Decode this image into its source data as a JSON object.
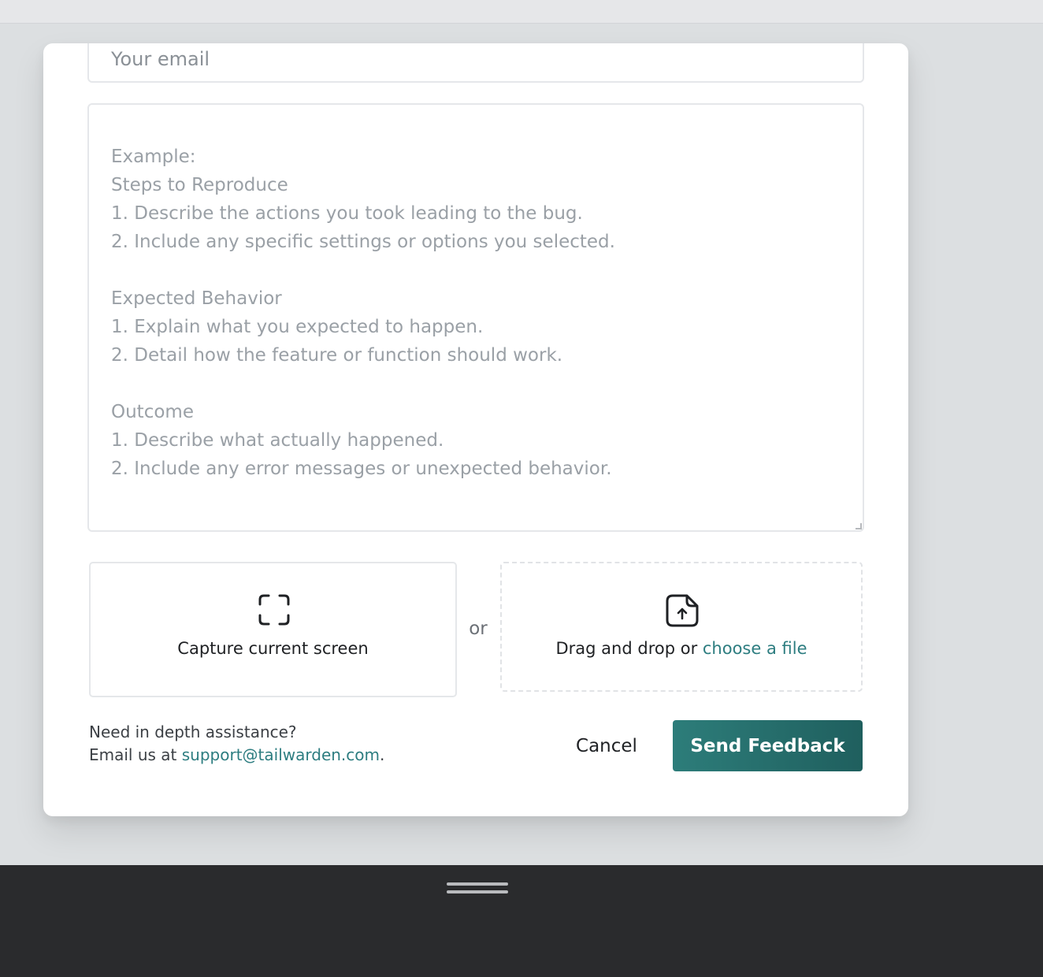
{
  "form": {
    "email_placeholder": "Your email",
    "description_placeholder": "Example:\nSteps to Reproduce\n1. Describe the actions you took leading to the bug.\n2. Include any specific settings or options you selected.\n\nExpected Behavior\n1. Explain what you expected to happen.\n2. Detail how the feature or function should work.\n\nOutcome\n1. Describe what actually happened.\n2. Include any error messages or unexpected behavior."
  },
  "attachments": {
    "capture_label": "Capture current screen",
    "or_label": "or",
    "drop_prefix": "Drag and drop or ",
    "drop_link": "choose a file"
  },
  "footer": {
    "help_line1": "Need in depth assistance?",
    "help_line2_prefix": "Email us at ",
    "support_email": "support@tailwarden.com",
    "help_line2_suffix": ".",
    "cancel_label": "Cancel",
    "send_label": "Send Feedback"
  },
  "colors": {
    "accent": "#2d7d80",
    "primary_button": "#276e6c",
    "bottom_bar": "#2a2b2d"
  },
  "icons": {
    "capture": "screen-capture-icon",
    "upload": "file-upload-icon"
  }
}
